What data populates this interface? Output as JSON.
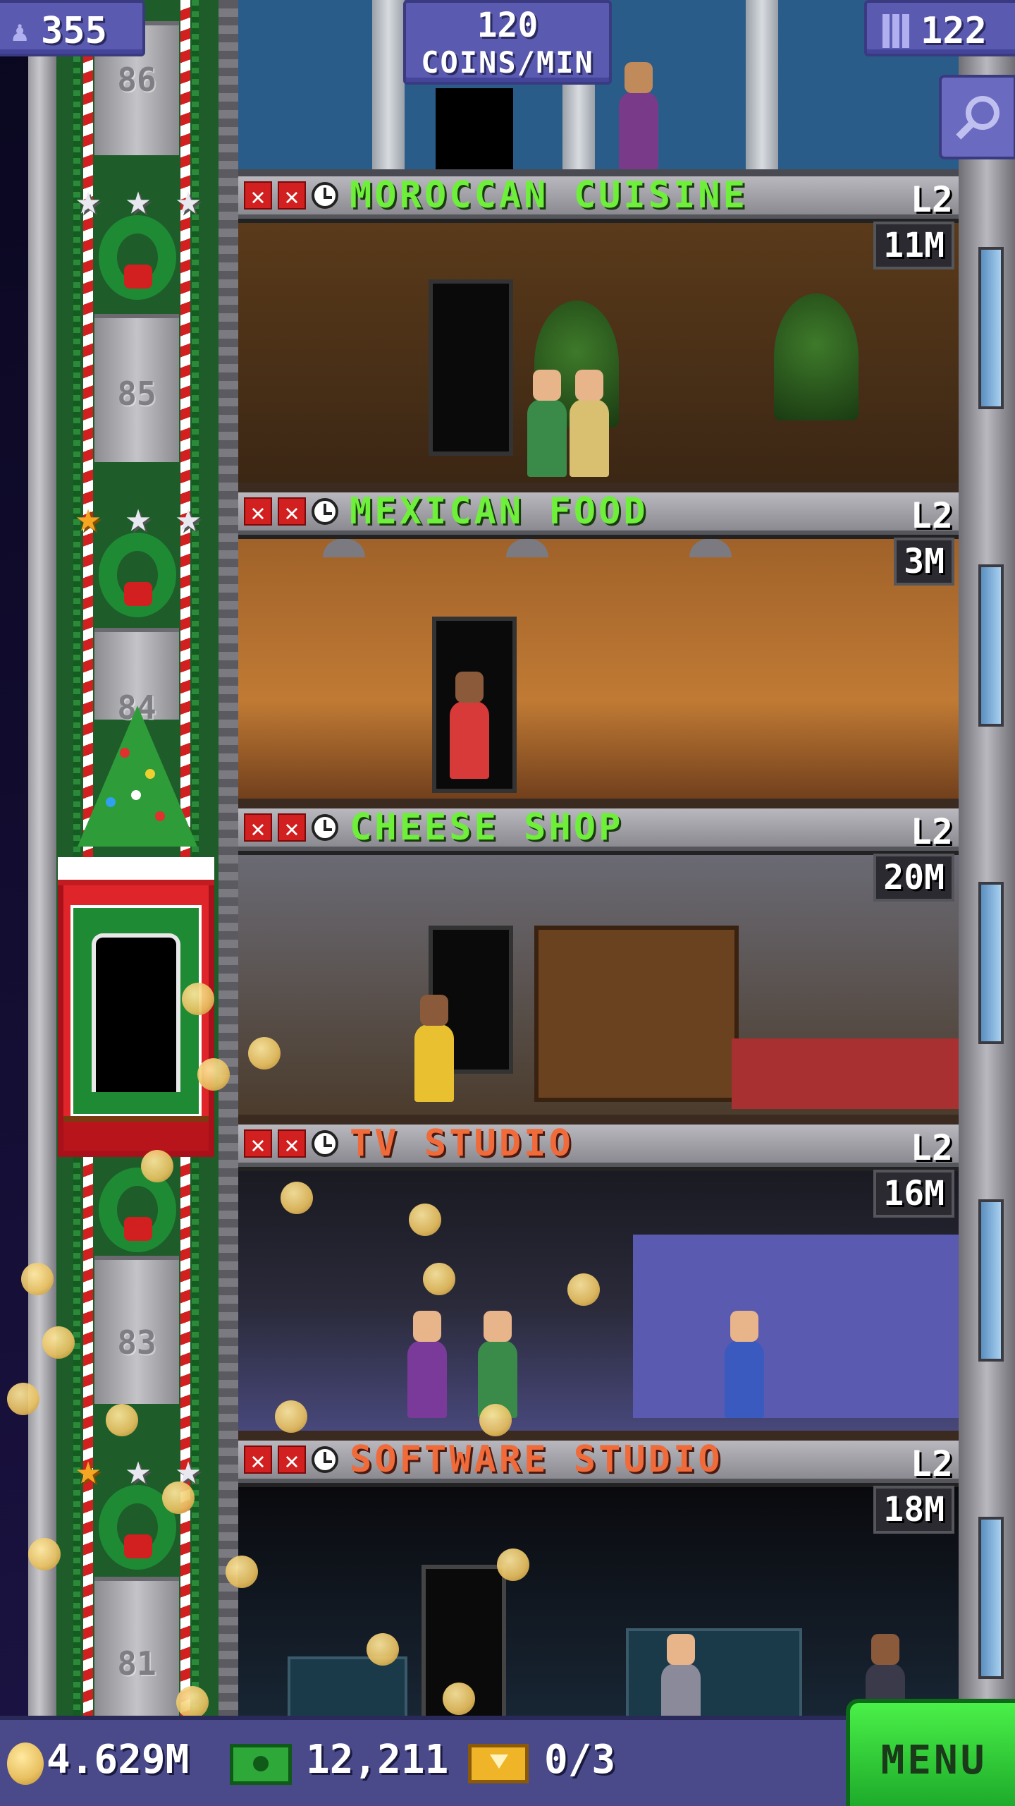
{
  "hud": {
    "population": "355",
    "rate_value": "120",
    "rate_unit": "COINS/MIN",
    "floors_count": "122",
    "population_icon": "person-icon",
    "floors_icon": "building-icon",
    "zoom_icon": "magnifier-icon"
  },
  "elevator": {
    "floor_numbers": {
      "f86": "86",
      "f85": "85",
      "f84": "84",
      "f83": "83",
      "f81": "81"
    }
  },
  "floors": [
    {
      "name": "MOROCCAN CUISINE",
      "level": "L2",
      "value": "11M",
      "name_color": "#6ef03a"
    },
    {
      "name": "MEXICAN FOOD",
      "level": "L2",
      "value": "3M",
      "name_color": "#6ef03a"
    },
    {
      "name": "CHEESE SHOP",
      "level": "L2",
      "value": "20M",
      "name_color": "#6ef03a"
    },
    {
      "name": "TV STUDIO",
      "level": "L2",
      "value": "16M",
      "name_color": "#f06a3a"
    },
    {
      "name": "SOFTWARE STUDIO",
      "level": "L2",
      "value": "18M",
      "name_color": "#f06a3a"
    }
  ],
  "bottom_bar": {
    "coins": "4.629M",
    "bux": "12,211",
    "tickets": "0/3",
    "menu_label": "MENU"
  },
  "colors": {
    "accent_green": "#6ef03a",
    "accent_orange": "#f06a3a",
    "hud_purple": "#5a5ab0",
    "menu_green": "#2fd03a"
  }
}
